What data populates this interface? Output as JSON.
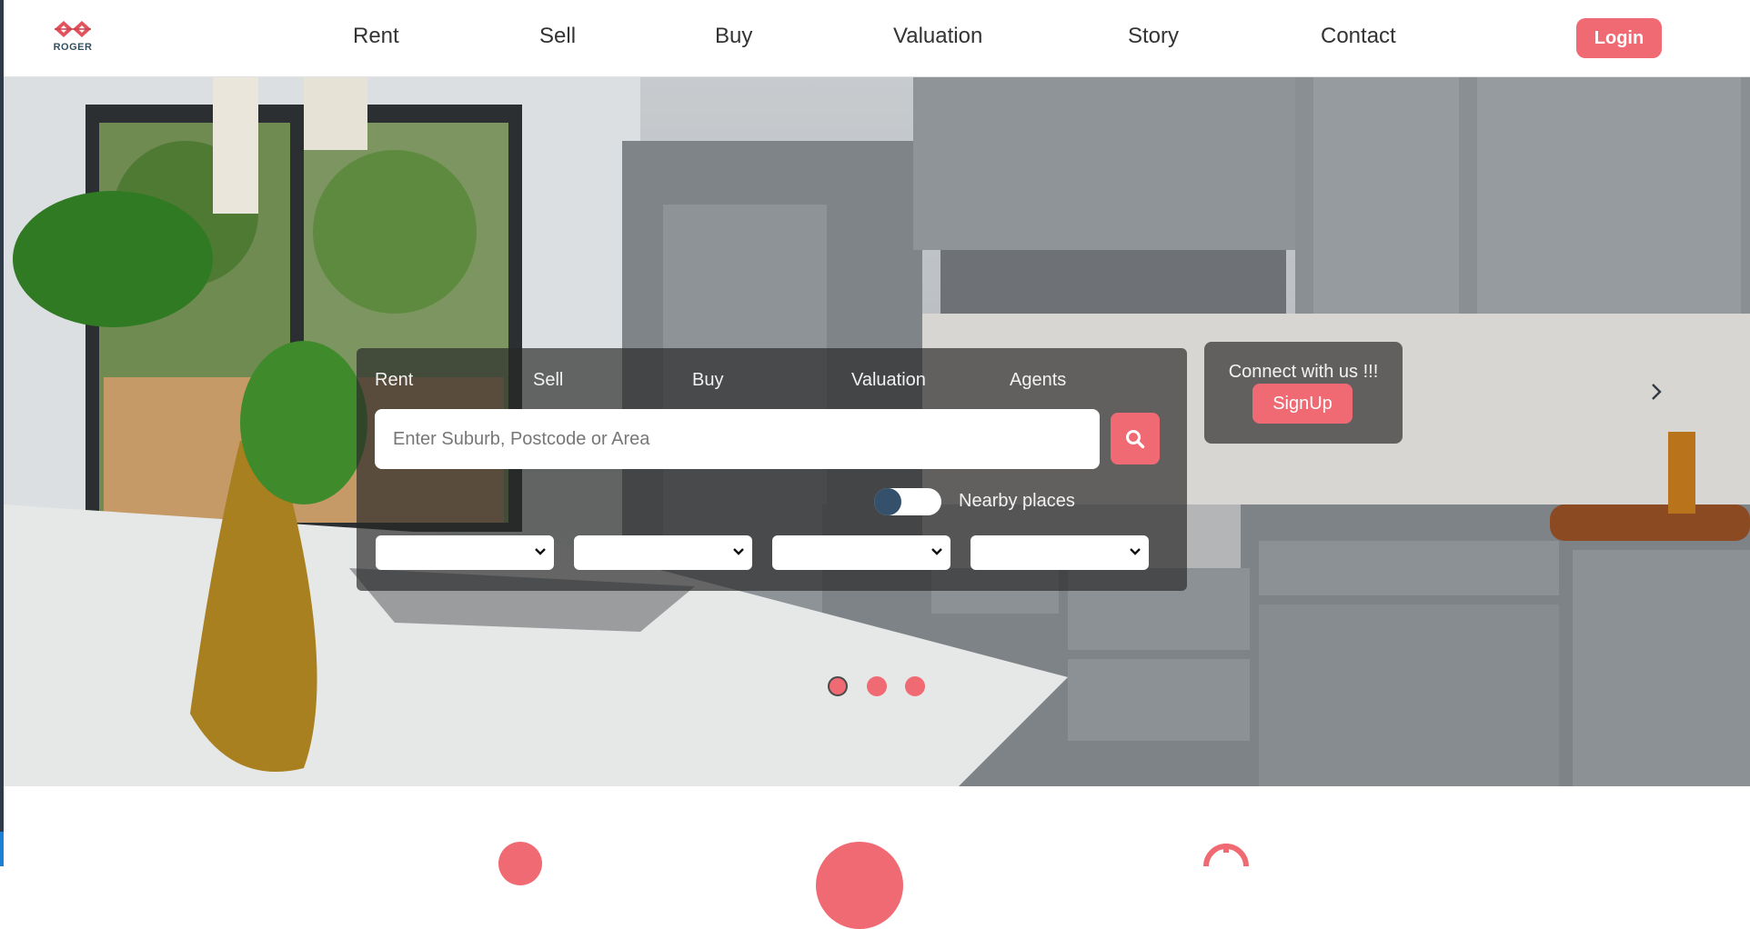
{
  "brand": {
    "name": "ROGER"
  },
  "nav": {
    "items": [
      {
        "label": "Rent"
      },
      {
        "label": "Sell"
      },
      {
        "label": "Buy"
      },
      {
        "label": "Valuation"
      },
      {
        "label": "Story"
      },
      {
        "label": "Contact"
      }
    ],
    "login_label": "Login"
  },
  "search": {
    "tabs": [
      {
        "label": "Rent"
      },
      {
        "label": "Sell"
      },
      {
        "label": "Buy"
      },
      {
        "label": "Valuation"
      },
      {
        "label": "Agents"
      }
    ],
    "placeholder": "Enter Suburb, Postcode or Area",
    "value": "",
    "button_icon": "search-icon",
    "nearby_toggle": {
      "label": "Nearby places",
      "on": false
    },
    "filters": [
      {
        "selected": ""
      },
      {
        "selected": ""
      },
      {
        "selected": ""
      },
      {
        "selected": ""
      }
    ]
  },
  "connect": {
    "text": "Connect with us !!!",
    "signup_label": "SignUp"
  },
  "carousel": {
    "slide_count": 3,
    "active_index": 0,
    "next_icon": "chevron-right-icon"
  },
  "colors": {
    "accent": "#f06a73",
    "nav_text": "#333333",
    "panel": "rgba(40,40,40,0.68)",
    "toggle_knob": "#34506a"
  }
}
